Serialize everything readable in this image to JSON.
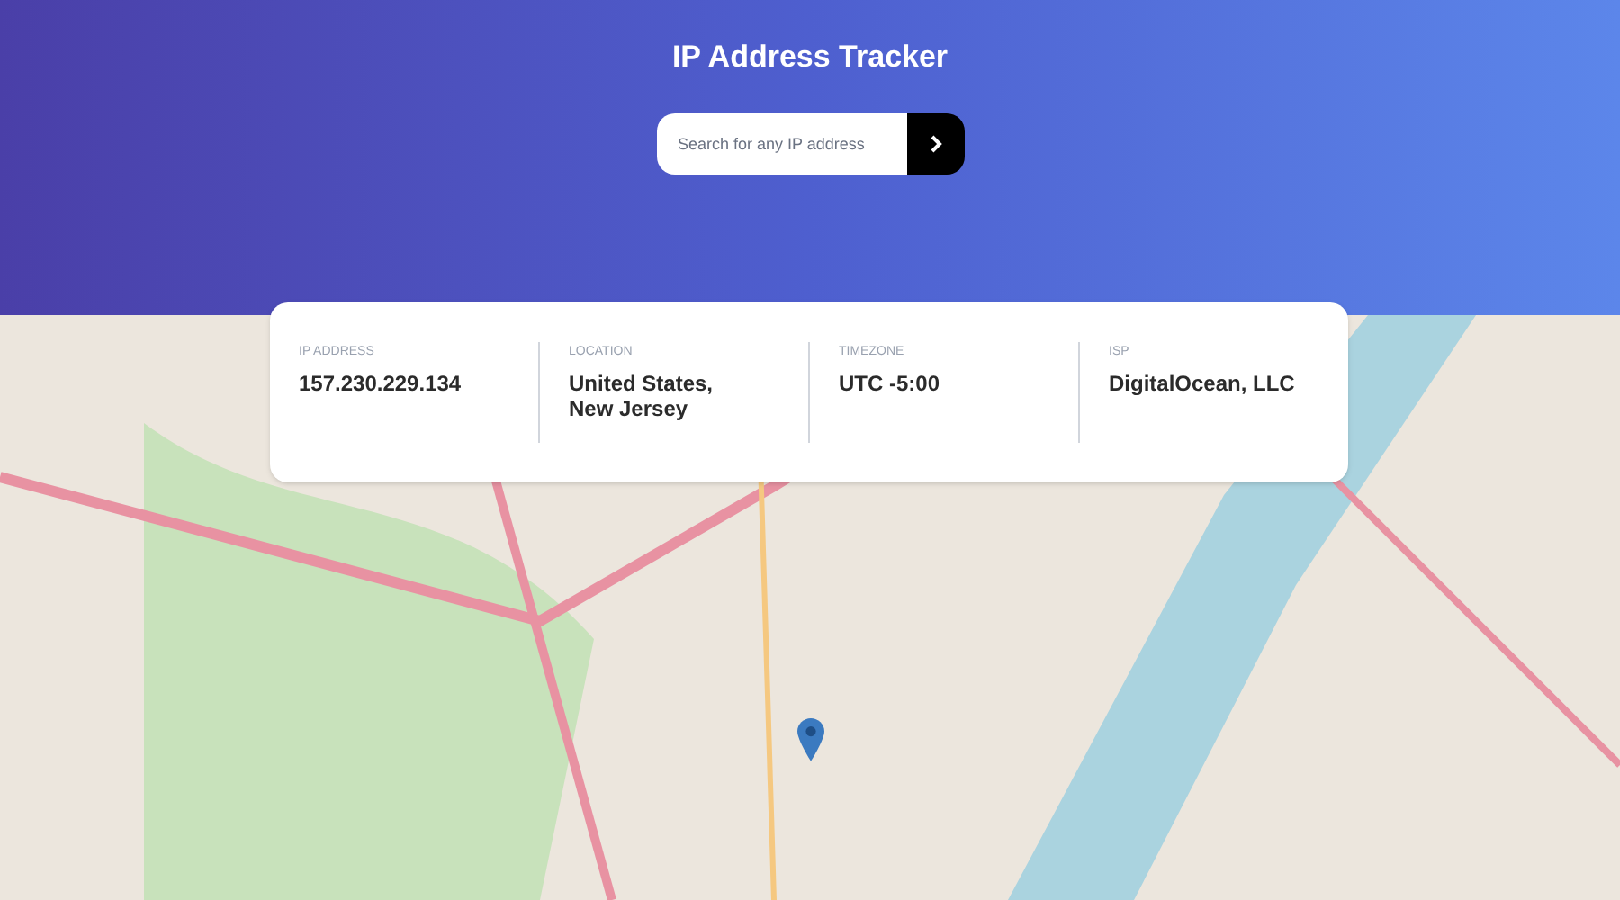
{
  "title": "IP Address Tracker",
  "search": {
    "placeholder": "Search for any IP address"
  },
  "details": [
    {
      "label": "IP ADDRESS",
      "value": "157.230.229.134"
    },
    {
      "label": "LOCATION",
      "value": "United States,\nNew Jersey"
    },
    {
      "label": "TIMEZONE",
      "value": "UTC -5:00"
    },
    {
      "label": "ISP",
      "value": "DigitalOcean, LLC"
    }
  ]
}
